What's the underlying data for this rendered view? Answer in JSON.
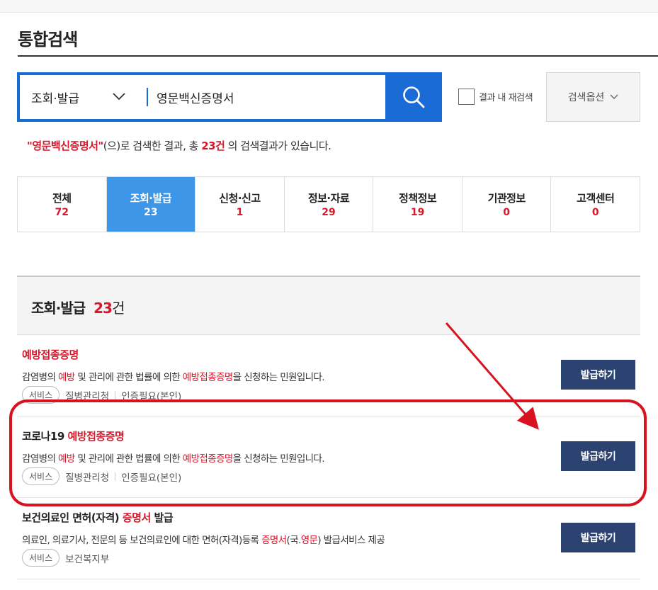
{
  "page": {
    "title": "통합검색"
  },
  "search": {
    "category_label": "조회·발급",
    "query": "영문백신증명서",
    "recheck_label": "결과 내 재검색",
    "options_label": "검색옵션"
  },
  "summary": {
    "quoted_query": "\"영문백신증명서\"",
    "text_before_total": "(으)로 검색한 결과, 총 ",
    "total": "23건",
    "text_after": " 의 검색결과가 있습니다."
  },
  "tabs": [
    {
      "label": "전체",
      "count": "72",
      "active": false
    },
    {
      "label": "조회·발급",
      "count": "23",
      "active": true
    },
    {
      "label": "신청·신고",
      "count": "1",
      "active": false
    },
    {
      "label": "정보·자료",
      "count": "29",
      "active": false
    },
    {
      "label": "정책정보",
      "count": "19",
      "active": false
    },
    {
      "label": "기관정보",
      "count": "0",
      "active": false
    },
    {
      "label": "고객센터",
      "count": "0",
      "active": false
    }
  ],
  "section": {
    "title": "조회·발급",
    "count": "23",
    "unit": "건"
  },
  "results": [
    {
      "title_plain": "",
      "title_highlight": "예방접종증명",
      "title_suffix": "",
      "desc": [
        "감염병의 ",
        "예방",
        " 및 관리에 관한 법률에 의한 ",
        "예방접종증명",
        "을 신청하는 민원입니다."
      ],
      "tag": "서비스",
      "agency": "질병관리청",
      "auth": "인증필요(본인)",
      "button": "발급하기"
    },
    {
      "title_plain": "코로나19 ",
      "title_highlight": "예방접종증명",
      "title_suffix": "",
      "desc": [
        "감염병의 ",
        "예방",
        " 및 관리에 관한 법률에 의한 ",
        "예방접종증명",
        "을 신청하는 민원입니다."
      ],
      "tag": "서비스",
      "agency": "질병관리청",
      "auth": "인증필요(본인)",
      "button": "발급하기"
    },
    {
      "title_plain": "보건의료인 면허(자격) ",
      "title_highlight": "증명서",
      "title_suffix": " 발급",
      "desc": [
        "의료인, 의료기사, 전문의 등 보건의료인에 대한 면허(자격)등록 ",
        "증명서",
        "(국.",
        "영문",
        ") 발급서비스 제공"
      ],
      "tag": "서비스",
      "agency": "보건복지부",
      "auth": "",
      "button": "발급하기"
    }
  ],
  "colors": {
    "primary_blue": "#1a6bd6",
    "active_tab": "#3e96e8",
    "highlight_red": "#d6182a",
    "button_navy": "#2c4271",
    "annotation_red": "#d8121f"
  }
}
